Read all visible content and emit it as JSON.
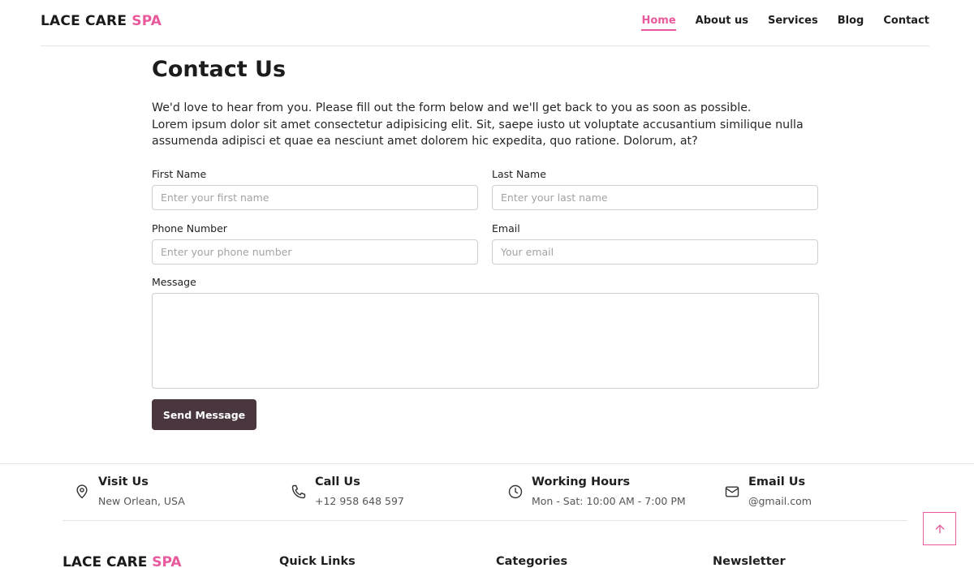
{
  "brand": {
    "name": "LACE CARE",
    "accent": "SPA"
  },
  "nav": {
    "items": [
      "Home",
      "About us",
      "Services",
      "Blog",
      "Contact"
    ],
    "active_index": 0
  },
  "contact": {
    "title": "Contact Us",
    "intro_line1": "We'd love to hear from you. Please fill out the form below and we'll get back to you as soon as possible.",
    "intro_line2": "Lorem ipsum dolor sit amet consectetur adipisicing elit. Sit, saepe iusto ut voluptate accusantium similique nulla assumenda adipisci et quae ea nesciunt amet dolorem hic expedita, quo ratione. Dolorum, at?"
  },
  "form": {
    "first_name": {
      "label": "First Name",
      "placeholder": "Enter your first name",
      "value": ""
    },
    "last_name": {
      "label": "Last Name",
      "placeholder": "Enter your last name",
      "value": ""
    },
    "phone": {
      "label": "Phone Number",
      "placeholder": "Enter your phone number",
      "value": ""
    },
    "email": {
      "label": "Email",
      "placeholder": "Your email",
      "value": ""
    },
    "message": {
      "label": "Message",
      "value": ""
    },
    "submit_label": "Send Message"
  },
  "info": {
    "visit": {
      "title": "Visit Us",
      "text": "New Orlean, USA",
      "icon": "map-pin-icon"
    },
    "call": {
      "title": "Call Us",
      "text": "+12 958 648 597",
      "icon": "phone-icon"
    },
    "hours": {
      "title": "Working Hours",
      "text": "Mon - Sat: 10:00 AM - 7:00 PM",
      "icon": "clock-icon"
    },
    "email": {
      "title": "Email Us",
      "text": "@gmail.com",
      "icon": "mail-icon"
    }
  },
  "footer": {
    "columns": [
      "Quick Links",
      "Categories",
      "Newsletter"
    ]
  },
  "colors": {
    "accent": "#e95a9c",
    "button": "#4a363f",
    "border": "#cfcfcf"
  }
}
